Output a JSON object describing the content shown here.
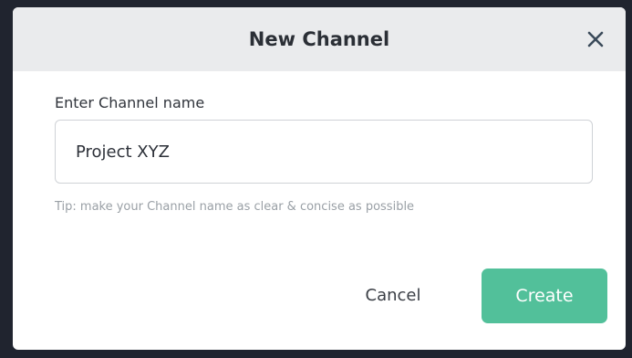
{
  "dialog": {
    "title": "New Channel",
    "close_icon": "close-icon"
  },
  "form": {
    "label": "Enter Channel name",
    "value": "Project XYZ",
    "tip": "Tip: make your Channel name as clear & concise as possible"
  },
  "actions": {
    "cancel_label": "Cancel",
    "create_label": "Create"
  },
  "colors": {
    "accent": "#52c09a",
    "header_bg": "#eaebed",
    "overlay_bg": "#20242f"
  }
}
